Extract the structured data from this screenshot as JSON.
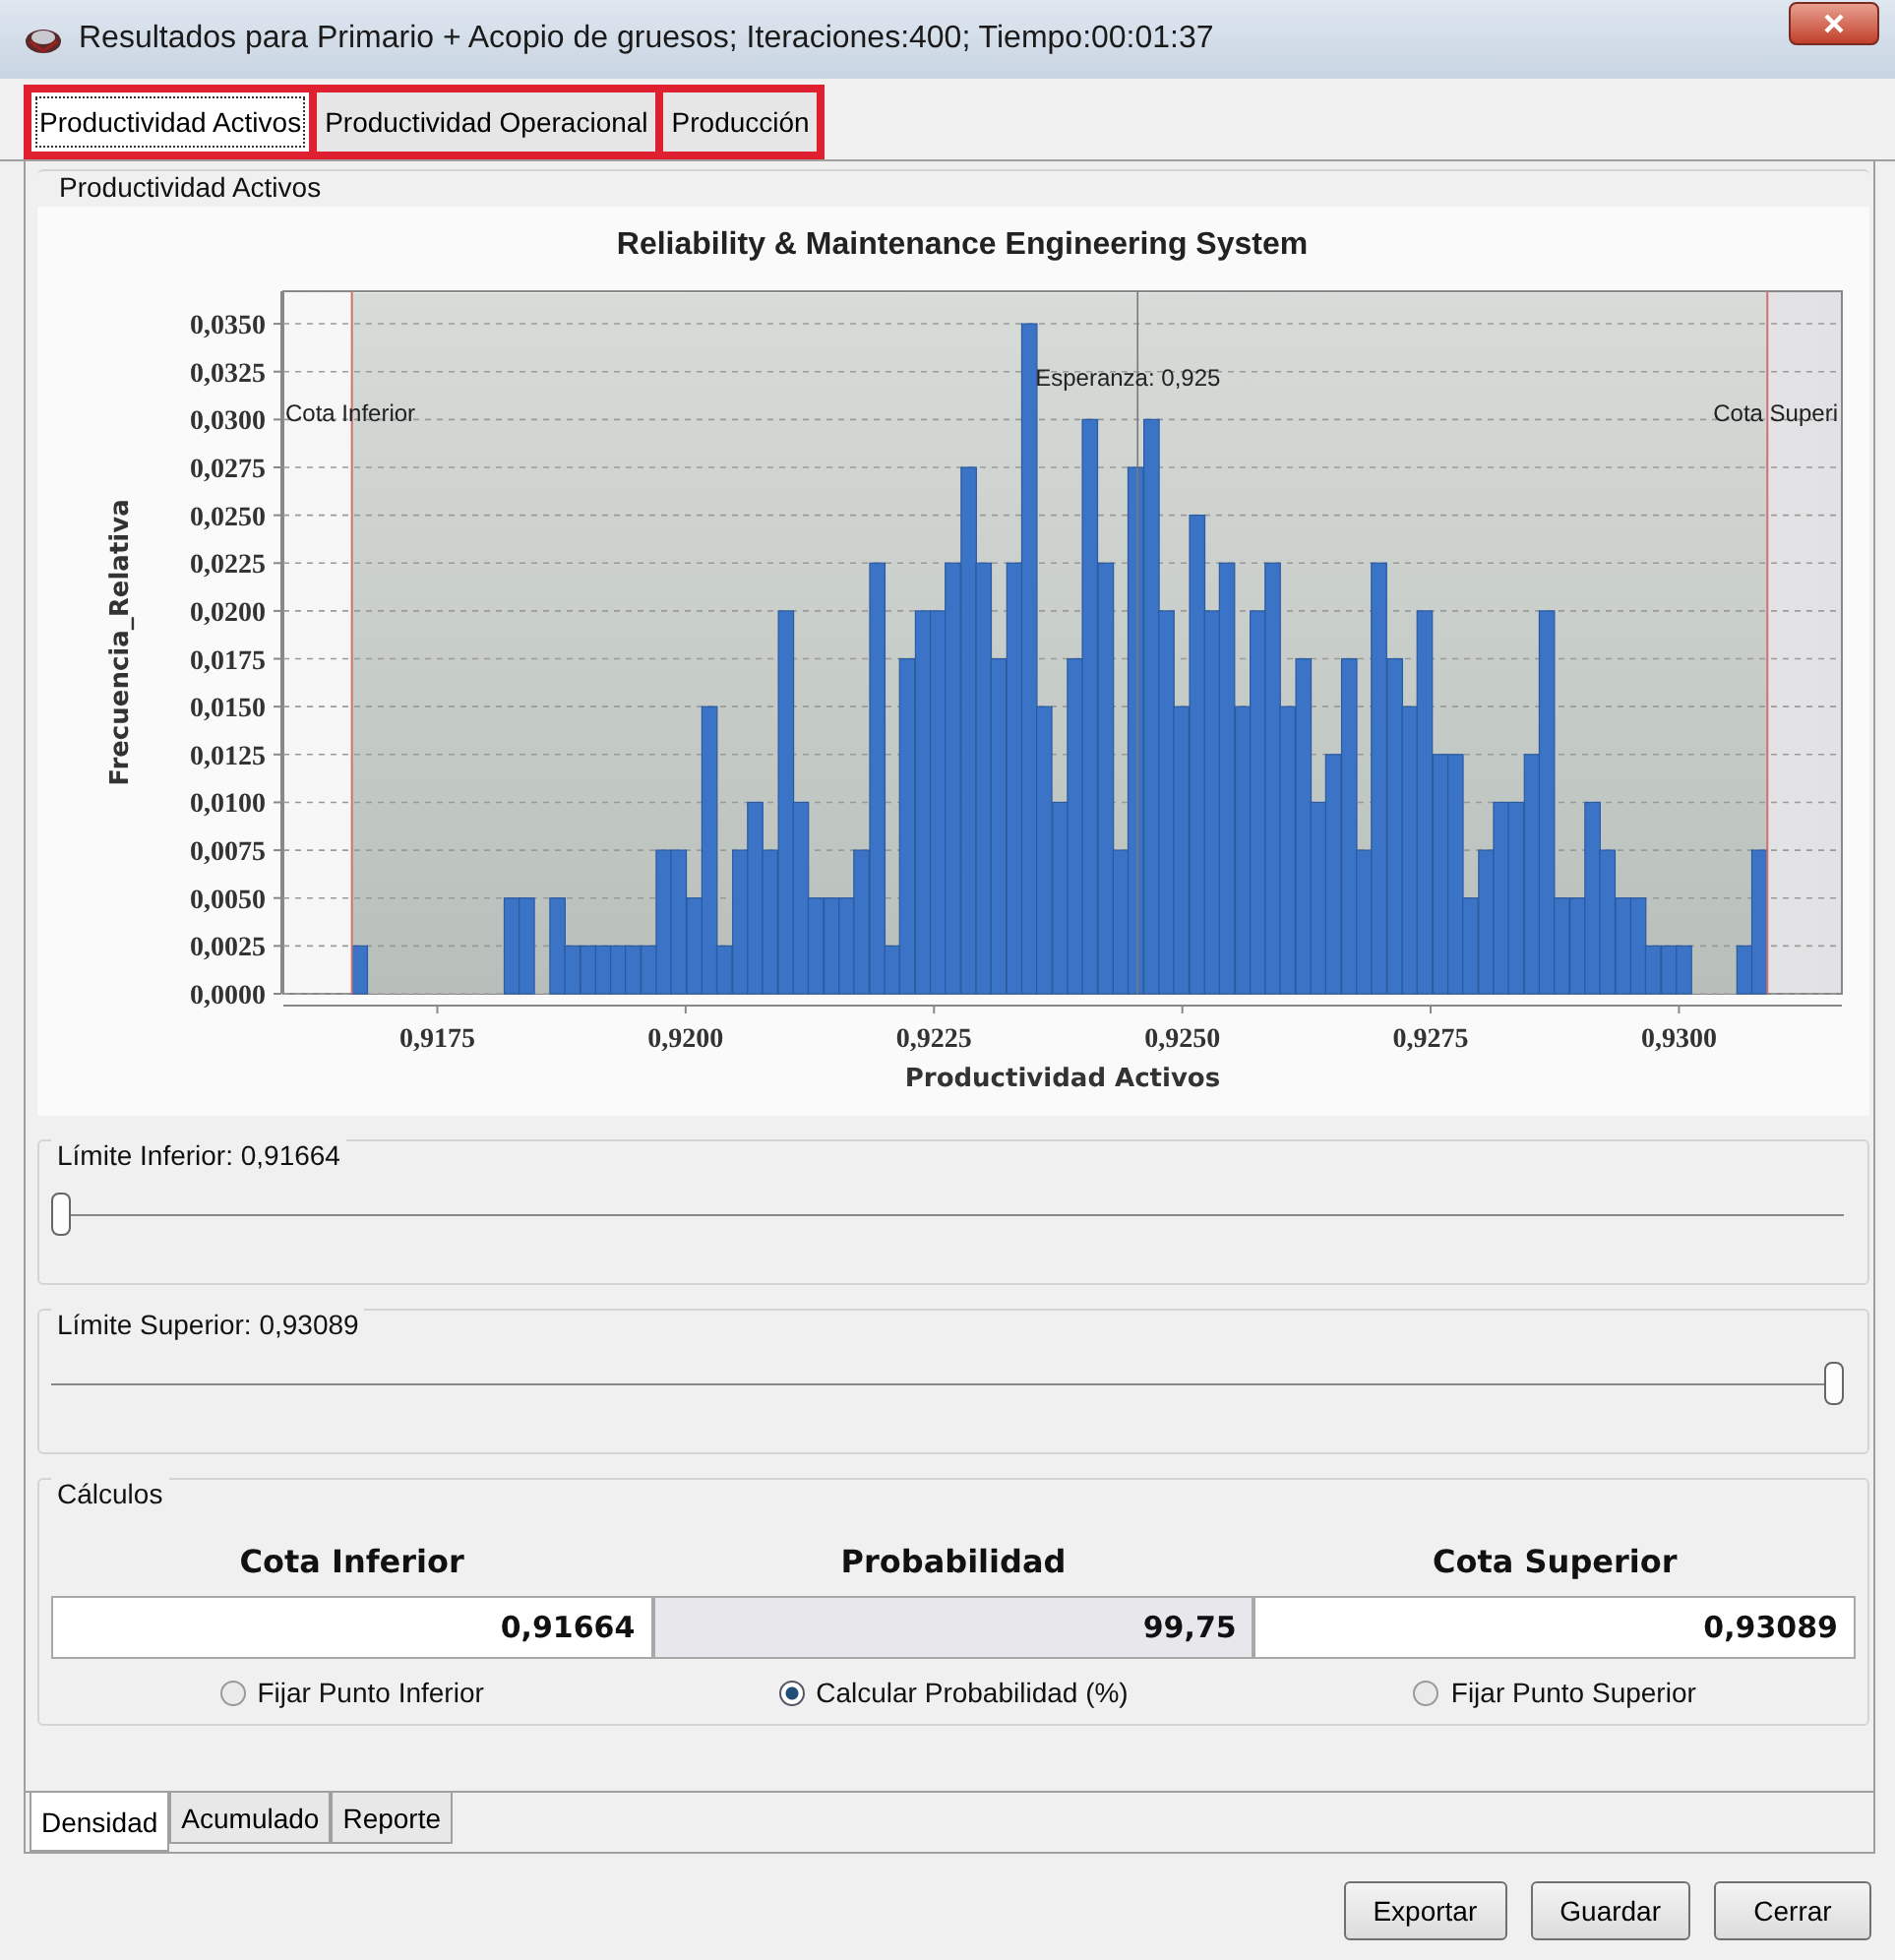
{
  "window": {
    "title": "Resultados para Primario + Acopio de gruesos; Iteraciones:400; Tiempo:00:01:37"
  },
  "tabs": [
    {
      "label": "Productividad Activos",
      "selected": true
    },
    {
      "label": "Productividad Operacional",
      "selected": false
    },
    {
      "label": "Producción",
      "selected": false
    }
  ],
  "panel": {
    "title": "Productividad Activos",
    "chart_data": {
      "type": "bar",
      "title": "Reliability & Maintenance Engineering System",
      "xlabel": "Productividad Activos",
      "ylabel": "Frecuencia_Relativa",
      "x": [
        0.91672,
        0.91687,
        0.91702,
        0.91718,
        0.91733,
        0.91748,
        0.91764,
        0.91779,
        0.91794,
        0.9181,
        0.91825,
        0.9184,
        0.91856,
        0.91871,
        0.91886,
        0.91902,
        0.91917,
        0.91932,
        0.91947,
        0.91963,
        0.91978,
        0.91993,
        0.92009,
        0.92024,
        0.92039,
        0.92055,
        0.9207,
        0.92085,
        0.92101,
        0.92116,
        0.92131,
        0.92147,
        0.92162,
        0.92177,
        0.92193,
        0.92208,
        0.92223,
        0.92239,
        0.92254,
        0.92269,
        0.92285,
        0.923,
        0.92315,
        0.92331,
        0.92346,
        0.92361,
        0.92377,
        0.92392,
        0.92407,
        0.92423,
        0.92438,
        0.92453,
        0.92469,
        0.92484,
        0.92499,
        0.92515,
        0.9253,
        0.92545,
        0.92561,
        0.92576,
        0.92591,
        0.92606,
        0.92622,
        0.92637,
        0.92652,
        0.92668,
        0.92683,
        0.92698,
        0.92714,
        0.92729,
        0.92744,
        0.9276,
        0.92775,
        0.9279,
        0.92806,
        0.92821,
        0.92836,
        0.92852,
        0.92867,
        0.92882,
        0.92898,
        0.92913,
        0.92928,
        0.92944,
        0.92959,
        0.92974,
        0.9299,
        0.93005,
        0.9302,
        0.93035,
        0.93051,
        0.93066,
        0.93081
      ],
      "grid": true,
      "values": [
        0.0025,
        0,
        0,
        0,
        0,
        0,
        0,
        0,
        0,
        0,
        0.005,
        0.005,
        0,
        0.005,
        0.0025,
        0.0025,
        0.0025,
        0.0025,
        0.0025,
        0.0025,
        0.0075,
        0.0075,
        0.005,
        0.015,
        0.0025,
        0.0075,
        0.01,
        0.0075,
        0.02,
        0.01,
        0.005,
        0.005,
        0.005,
        0.0075,
        0.0225,
        0.0025,
        0.0175,
        0.02,
        0.02,
        0.0225,
        0.0275,
        0.0225,
        0.0175,
        0.0225,
        0.035,
        0.015,
        0.01,
        0.0175,
        0.03,
        0.0225,
        0.0075,
        0.0275,
        0.03,
        0.02,
        0.015,
        0.025,
        0.02,
        0.0225,
        0.015,
        0.02,
        0.0225,
        0.015,
        0.0175,
        0.01,
        0.0125,
        0.0175,
        0.0075,
        0.0225,
        0.0175,
        0.015,
        0.02,
        0.0125,
        0.0125,
        0.005,
        0.0075,
        0.01,
        0.01,
        0.0125,
        0.02,
        0.005,
        0.005,
        0.01,
        0.0075,
        0.005,
        0.005,
        0.0025,
        0.0025,
        0.0025,
        0,
        0,
        0,
        0.0025,
        0.0075
      ],
      "xlim": [
        0.91595,
        0.93164
      ],
      "ylim": [
        0,
        0.0367
      ],
      "xticks": [
        {
          "value": 0.9175,
          "label": "0,9175"
        },
        {
          "value": 0.92,
          "label": "0,9200"
        },
        {
          "value": 0.9225,
          "label": "0,9225"
        },
        {
          "value": 0.925,
          "label": "0,9250"
        },
        {
          "value": 0.9275,
          "label": "0,9275"
        },
        {
          "value": 0.93,
          "label": "0,9300"
        }
      ],
      "yticks": [
        {
          "value": 0,
          "label": "0,0000"
        },
        {
          "value": 0.0025,
          "label": "0,0025"
        },
        {
          "value": 0.005,
          "label": "0,0050"
        },
        {
          "value": 0.0075,
          "label": "0,0075"
        },
        {
          "value": 0.01,
          "label": "0,0100"
        },
        {
          "value": 0.0125,
          "label": "0,0125"
        },
        {
          "value": 0.015,
          "label": "0,0150"
        },
        {
          "value": 0.0175,
          "label": "0,0175"
        },
        {
          "value": 0.02,
          "label": "0,0200"
        },
        {
          "value": 0.0225,
          "label": "0,0225"
        },
        {
          "value": 0.025,
          "label": "0,0250"
        },
        {
          "value": 0.0275,
          "label": "0,0275"
        },
        {
          "value": 0.03,
          "label": "0,0300"
        },
        {
          "value": 0.0325,
          "label": "0,0325"
        },
        {
          "value": 0.035,
          "label": "0,0350"
        }
      ],
      "bands": [
        {
          "axis": "x",
          "from": 0.91664,
          "to": 0.93089
        }
      ],
      "ref_lines": [
        {
          "axis": "x",
          "value": 0.91664,
          "label": "Cota Inferior",
          "color": "#d07070"
        },
        {
          "axis": "x",
          "value": 0.93089,
          "label": "Cota Superi",
          "color": "#d07070"
        },
        {
          "axis": "x",
          "value": 0.92455,
          "label": "Esperanza: 0,925",
          "color": "#7a7a7a"
        }
      ]
    }
  },
  "sliders": [
    {
      "label": "Límite Inferior: 0,91664",
      "level": 0
    },
    {
      "label": "Límite Superior: 0,93089",
      "level": 1
    }
  ],
  "calculos": {
    "title": "Cálculos",
    "columns": [
      {
        "heading": "Cota Inferior",
        "value": "0,91664",
        "editable": true,
        "option": "Fijar Punto Inferior",
        "selected": false
      },
      {
        "heading": "Probabilidad",
        "value": "99,75",
        "editable": false,
        "option": "Calcular Probabilidad (%)",
        "selected": true
      },
      {
        "heading": "Cota Superior",
        "value": "0,93089",
        "editable": true,
        "option": "Fijar Punto Superior",
        "selected": false
      }
    ]
  },
  "view_tabs": [
    {
      "label": "Densidad",
      "selected": true
    },
    {
      "label": "Acumulado",
      "selected": false
    },
    {
      "label": "Reporte",
      "selected": false
    }
  ],
  "buttons": [
    "Exportar",
    "Guardar",
    "Cerrar"
  ]
}
